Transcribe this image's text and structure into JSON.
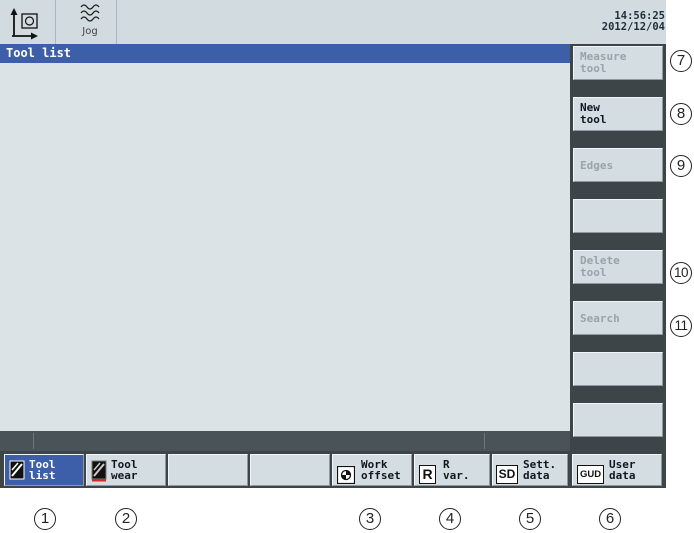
{
  "top_bar": {
    "mode_label": "Jog",
    "time": "14:56:25",
    "date": "2012/12/04"
  },
  "window": {
    "title": "Tool list"
  },
  "vertical_softkeys": [
    {
      "label": "Measure\ntool",
      "enabled": false
    },
    {
      "label": "New\ntool",
      "enabled": true
    },
    {
      "label": "Edges",
      "enabled": false
    },
    {
      "label": "",
      "enabled": false
    },
    {
      "label": "Delete\ntool",
      "enabled": false
    },
    {
      "label": "Search",
      "enabled": false
    },
    {
      "label": "",
      "enabled": false
    },
    {
      "label": "",
      "enabled": false
    }
  ],
  "horizontal_softkeys": [
    {
      "label": "Tool\nlist",
      "icon": "tool-list-icon",
      "selected": true
    },
    {
      "label": "Tool\nwear",
      "icon": "tool-wear-icon",
      "selected": false
    },
    {
      "label": "",
      "icon": "",
      "selected": false
    },
    {
      "label": "",
      "icon": "",
      "selected": false
    },
    {
      "label": "Work\noffset",
      "icon": "work-offset-icon",
      "selected": false
    },
    {
      "label": "R\nvar.",
      "icon": "r-variable-icon",
      "icon_text": "R",
      "selected": false
    },
    {
      "label": "Sett.\ndata",
      "icon": "setting-data-icon",
      "icon_text": "SD",
      "selected": false
    },
    {
      "label": "User\ndata",
      "icon": "user-data-icon",
      "icon_text": "GUD",
      "selected": false
    }
  ],
  "callouts": {
    "bottom": [
      "1",
      "2",
      "3",
      "4",
      "5",
      "6"
    ],
    "right": [
      "7",
      "8",
      "9",
      "10",
      "11"
    ]
  },
  "colors": {
    "title_bar": "#3d5ea8",
    "background": "#dbe3e7",
    "panel": "#3d4549"
  }
}
